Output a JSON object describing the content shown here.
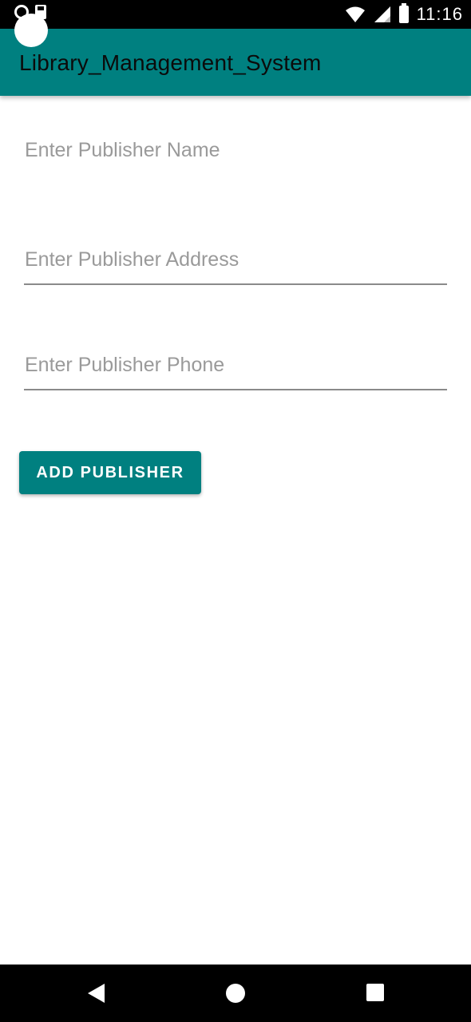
{
  "status_bar": {
    "time": "11:16",
    "icons": [
      "notification-dot-icon",
      "sd-card-icon",
      "wifi-icon",
      "cellular-signal-icon",
      "battery-icon"
    ]
  },
  "app_bar": {
    "title": "Library_Management_System"
  },
  "form": {
    "publisher_name": {
      "value": "",
      "placeholder": "Enter Publisher Name"
    },
    "publisher_address": {
      "value": "",
      "placeholder": "Enter Publisher Address"
    },
    "publisher_phone": {
      "value": "",
      "placeholder": "Enter Publisher Phone"
    },
    "add_button_label": "ADD PUBLISHER"
  },
  "nav_bar": {
    "icons": [
      "back-icon",
      "home-icon",
      "recent-apps-icon"
    ]
  },
  "colors": {
    "primary": "#008080",
    "background": "#FFFFFF",
    "hint": "#9A9A9A"
  }
}
